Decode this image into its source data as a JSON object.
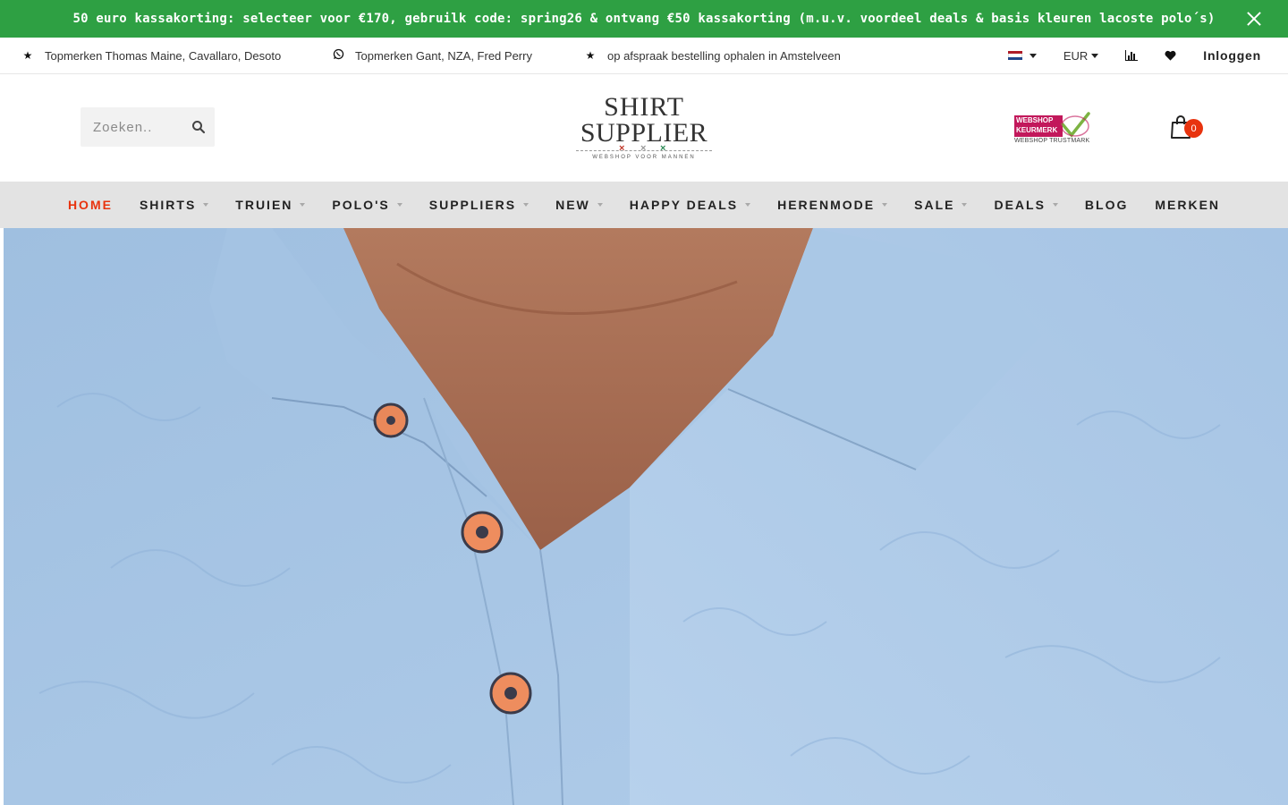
{
  "promo": {
    "text": "50 euro kassakorting: selecteer voor €170, gebruilk code: spring26 & ontvang €50 kassakorting (m.u.v. voordeel deals & basis kleuren lacoste polo´s)"
  },
  "usp": {
    "items": [
      {
        "icon": "star-icon",
        "text": "Topmerken Thomas Maine, Cavallaro, Desoto"
      },
      {
        "icon": "whatsapp-icon",
        "text": "Topmerken Gant, NZA, Fred Perry"
      },
      {
        "icon": "star-icon",
        "text": "op afspraak bestelling ophalen in Amstelveen"
      }
    ],
    "currency": "EUR",
    "login": "Inloggen"
  },
  "search": {
    "placeholder": "Zoeken.."
  },
  "logo": {
    "line1": "SHIRT",
    "line2": "SUPPLIER",
    "tagline": "WEBSHOP VOOR MANNEN"
  },
  "trustmark": {
    "line1": "WEBSHOP",
    "line2": "KEURMERK",
    "sub": "WEBSHOP TRUSTMARK"
  },
  "cart": {
    "count": "0"
  },
  "nav": {
    "items": [
      {
        "label": "HOME",
        "active": true,
        "dropdown": false
      },
      {
        "label": "SHIRTS",
        "active": false,
        "dropdown": true
      },
      {
        "label": "TRUIEN",
        "active": false,
        "dropdown": true
      },
      {
        "label": "POLO'S",
        "active": false,
        "dropdown": true
      },
      {
        "label": "SUPPLIERS",
        "active": false,
        "dropdown": true
      },
      {
        "label": "NEW",
        "active": false,
        "dropdown": true
      },
      {
        "label": "HAPPY DEALS",
        "active": false,
        "dropdown": true
      },
      {
        "label": "HERENMODE",
        "active": false,
        "dropdown": true
      },
      {
        "label": "SALE",
        "active": false,
        "dropdown": true
      },
      {
        "label": "DEALS",
        "active": false,
        "dropdown": true
      },
      {
        "label": "BLOG",
        "active": false,
        "dropdown": false
      },
      {
        "label": "MERKEN",
        "active": false,
        "dropdown": false
      }
    ]
  },
  "colors": {
    "promo_bg": "#2ea043",
    "accent": "#e8330e",
    "nav_bg": "#e3e3e3",
    "shirt": "#a9c8e8"
  }
}
